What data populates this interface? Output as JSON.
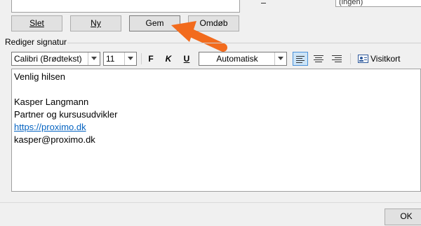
{
  "signature_buttons": {
    "delete": "Slet",
    "new": "Ny",
    "save": "Gem",
    "rename": "Omdøb"
  },
  "right_field_value": "(ingen)",
  "edit_section_label": "Rediger signatur",
  "toolbar": {
    "font_name": "Calibri (Brødtekst)",
    "font_size": "11",
    "bold": "F",
    "italic": "K",
    "underline": "U",
    "color": "Automatisk",
    "business_card": "Visitkort"
  },
  "signature_text": {
    "line1": "Venlig hilsen",
    "line2": "Kasper Langmann",
    "line3": "Partner og kursusudvikler",
    "link": "https://proximo.dk",
    "email": "kasper@proximo.dk"
  },
  "ok_label": "OK",
  "colors": {
    "annotation_arrow": "#f26b1d",
    "link": "#0563c1",
    "align_active": "#cce4f7"
  }
}
